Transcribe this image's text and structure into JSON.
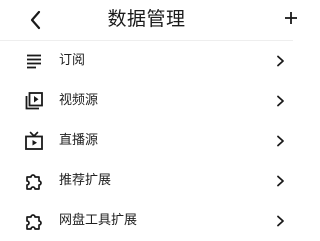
{
  "header": {
    "title": "数据管理",
    "back_icon": "back-arrow-icon",
    "more_icon": "add-icon"
  },
  "menu": {
    "items": [
      {
        "label": "订阅",
        "icon": "list-lines-icon"
      },
      {
        "label": "视频源",
        "icon": "video-library-icon"
      },
      {
        "label": "直播源",
        "icon": "live-tv-icon"
      },
      {
        "label": "推荐扩展",
        "icon": "extension-icon"
      },
      {
        "label": "网盘工具扩展",
        "icon": "extension-icon"
      }
    ]
  },
  "colors": {
    "background": "#ffffff",
    "text": "#202020",
    "icon": "#1a1a1a",
    "divider": "#eeeeee"
  }
}
